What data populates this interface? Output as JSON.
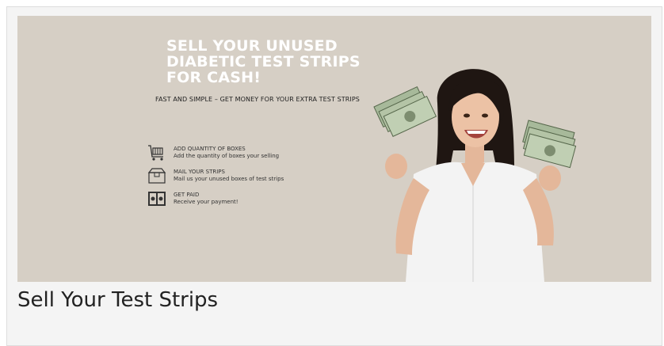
{
  "banner": {
    "headline": [
      "SELL YOUR UNUSED",
      "DIABETIC TEST STRIPS",
      "FOR CASH!"
    ],
    "subline": "FAST AND SIMPLE – GET MONEY FOR YOUR EXTRA TEST STRIPS",
    "steps": [
      {
        "title": "ADD QUANTITY OF BOXES",
        "desc": "Add the quantity of boxes your selling",
        "icon": "cart-icon"
      },
      {
        "title": "MAIL YOUR STRIPS",
        "desc": "Mail us your unused boxes of test strips",
        "icon": "box-icon"
      },
      {
        "title": "GET PAID",
        "desc": "Receive your payment!",
        "icon": "cash-icon"
      }
    ],
    "background_color": "#d6cfc5",
    "headline_color": "#ffffff"
  },
  "caption": "Sell Your Test Strips"
}
